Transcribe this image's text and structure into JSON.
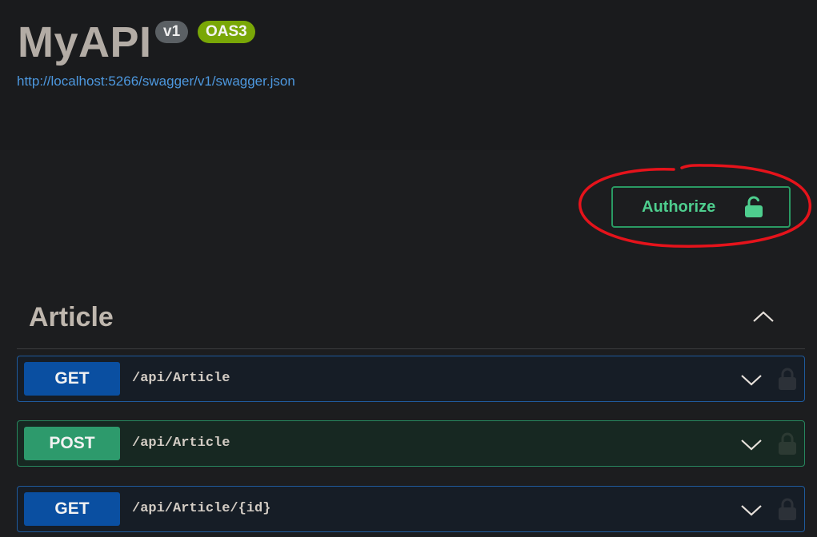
{
  "info": {
    "title": "MyAPI",
    "version_badge": "v1",
    "spec_badge": "OAS3",
    "spec_url": "http://localhost:5266/swagger/v1/swagger.json"
  },
  "authorize": {
    "label": "Authorize",
    "icon": "unlocked-padlock-icon",
    "highlight_color": "#e5131b"
  },
  "section": {
    "title": "Article",
    "icon": "chevron-up-icon"
  },
  "operations": [
    {
      "method": "GET",
      "path": "/api/Article"
    },
    {
      "method": "POST",
      "path": "/api/Article"
    },
    {
      "method": "GET",
      "path": "/api/Article/{id}"
    }
  ],
  "colors": {
    "get": "#0a4fa1",
    "post": "#2d9a6c",
    "authorize": "#4ece8e",
    "link": "#4d98df",
    "oas_badge": "#79a707"
  }
}
